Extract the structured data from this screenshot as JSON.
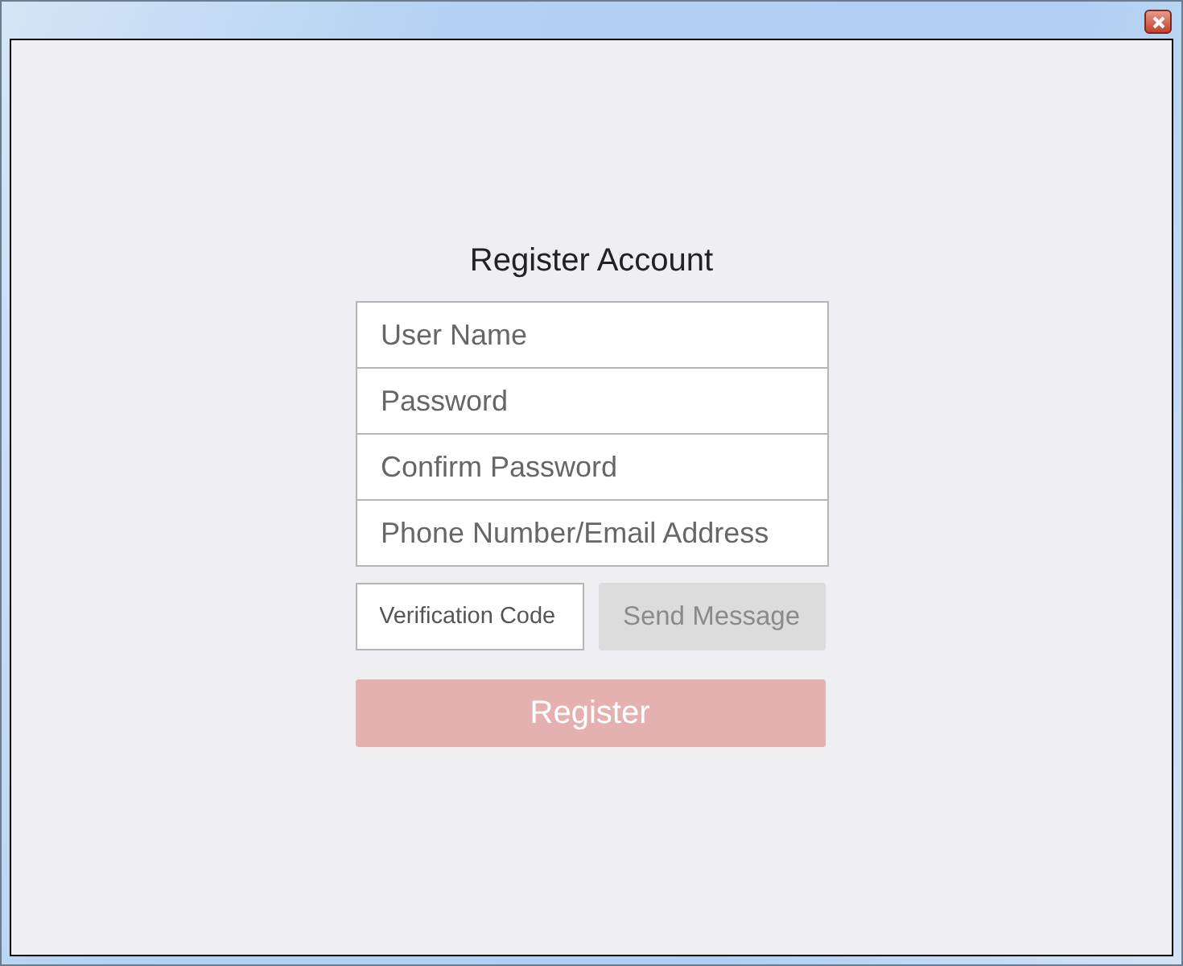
{
  "title": "Register Account",
  "fields": [
    {
      "placeholder": "User Name"
    },
    {
      "placeholder": "Password"
    },
    {
      "placeholder": "Confirm Password"
    },
    {
      "placeholder": "Phone Number/Email Address"
    }
  ],
  "verification": {
    "placeholder": "Verification Code"
  },
  "send_button": {
    "label": "Send Message",
    "disabled": true
  },
  "register_button": {
    "label": "Register"
  }
}
